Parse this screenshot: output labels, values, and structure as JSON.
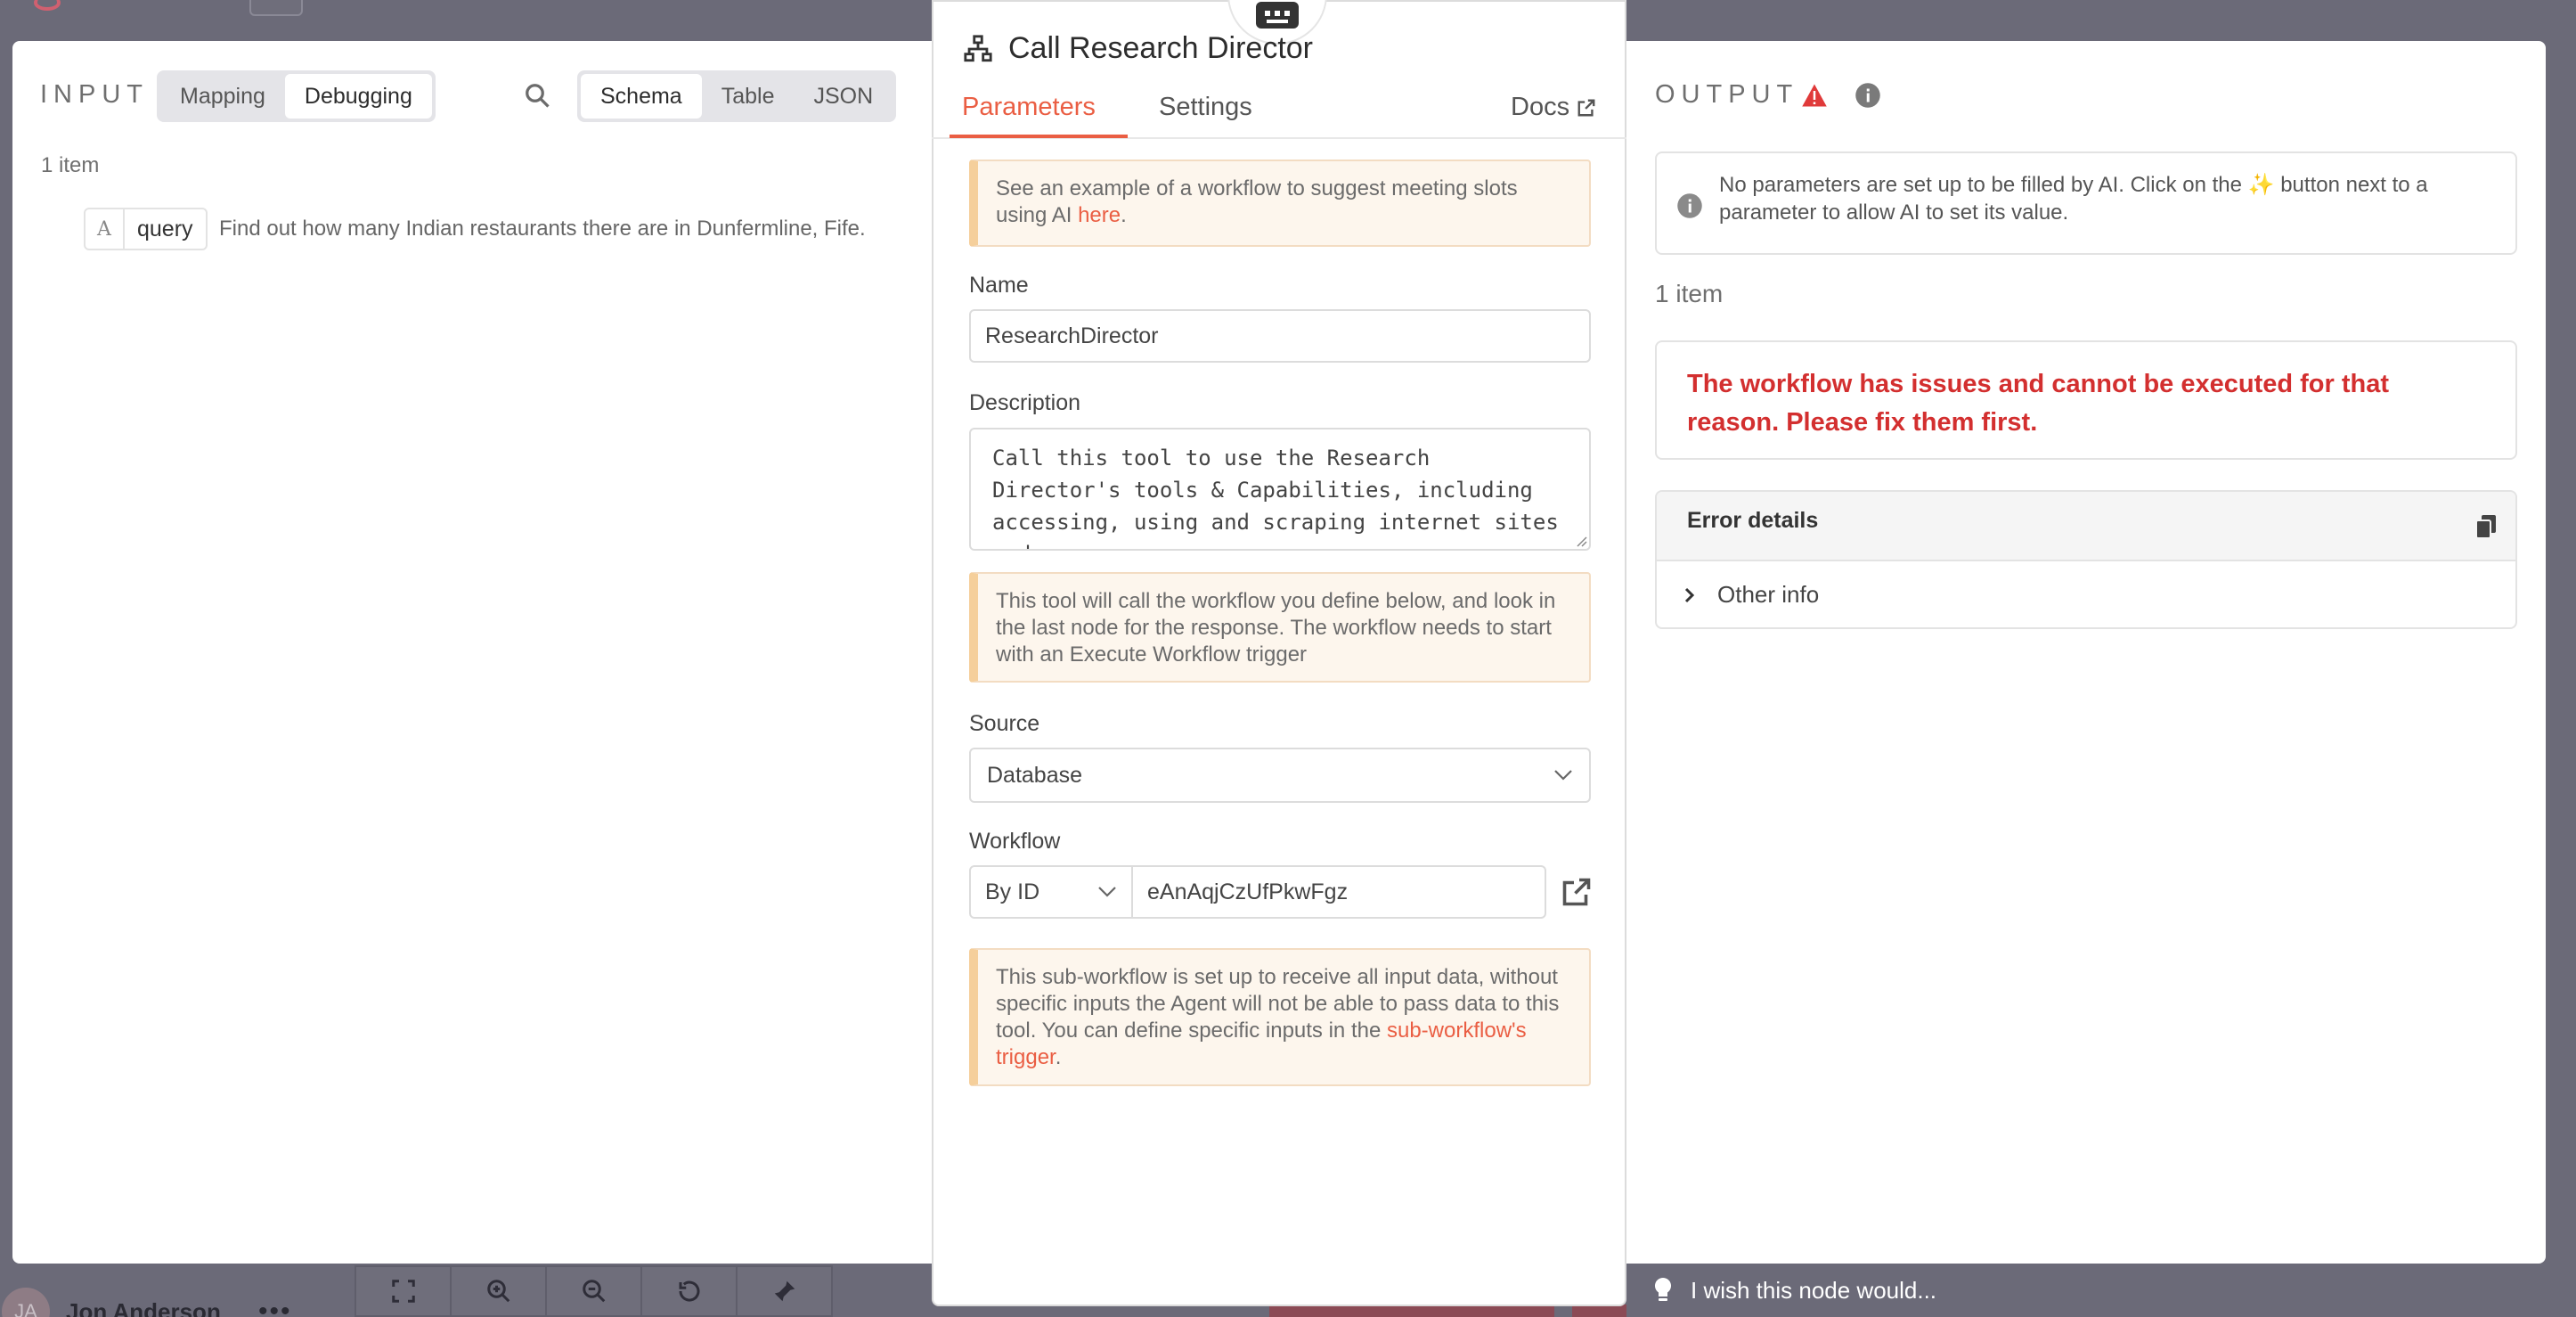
{
  "background": {
    "user": {
      "initials": "JA",
      "name": "Jon Anderson",
      "more": "•••"
    }
  },
  "input": {
    "label": "INPUT",
    "mode_tabs": [
      "Mapping",
      "Debugging"
    ],
    "mode_active": "Debugging",
    "view_tabs": [
      "Schema",
      "Table",
      "JSON"
    ],
    "view_active": "Schema",
    "items_count": "1 item",
    "field": {
      "type_glyph": "A",
      "name": "query",
      "value": "Find out how many Indian restaurants there are in Dunfermline, Fife."
    }
  },
  "panel": {
    "title": "Call Research Director",
    "tabs": {
      "parameters": "Parameters",
      "settings": "Settings",
      "docs": "Docs"
    },
    "notice_example": {
      "text": "See an example of a workflow to suggest meeting slots using AI ",
      "link": "here",
      "suffix": "."
    },
    "name_label": "Name",
    "name_value": "ResearchDirector",
    "description_label": "Description",
    "description_value": "Call this tool to use the Research Director's tools & Capabilities, including accessing, using and scraping internet sites and",
    "notice_tool": "This tool will call the workflow you define below, and look in the last node for the response. The workflow needs to start with an Execute Workflow trigger",
    "source_label": "Source",
    "source_value": "Database",
    "workflow_label": "Workflow",
    "workflow_mode": "By ID",
    "workflow_id": "eAnAqjCzUfPkwFgz",
    "notice_sub": {
      "text": "This sub-workflow is set up to receive all input data, without specific inputs the Agent will not be able to pass data to this tool. You can define specific inputs in the ",
      "link": "sub-workflow's trigger",
      "suffix": "."
    }
  },
  "output": {
    "label": "OUTPUT",
    "ai_notice_pre": "No parameters are set up to be filled by AI. Click on the ",
    "ai_notice_glyph": "✨",
    "ai_notice_post": " button next to a parameter to allow AI to set its value.",
    "items_count": "1 item",
    "error_message": "The workflow has issues and cannot be executed for that reason. Please fix them first.",
    "error_details_title": "Error details",
    "other_info": "Other info"
  },
  "feedback_hint": "I wish this node would...",
  "colors": {
    "accent": "#ea5e43",
    "error": "#d32f2f",
    "warning": "#e03a3a"
  }
}
